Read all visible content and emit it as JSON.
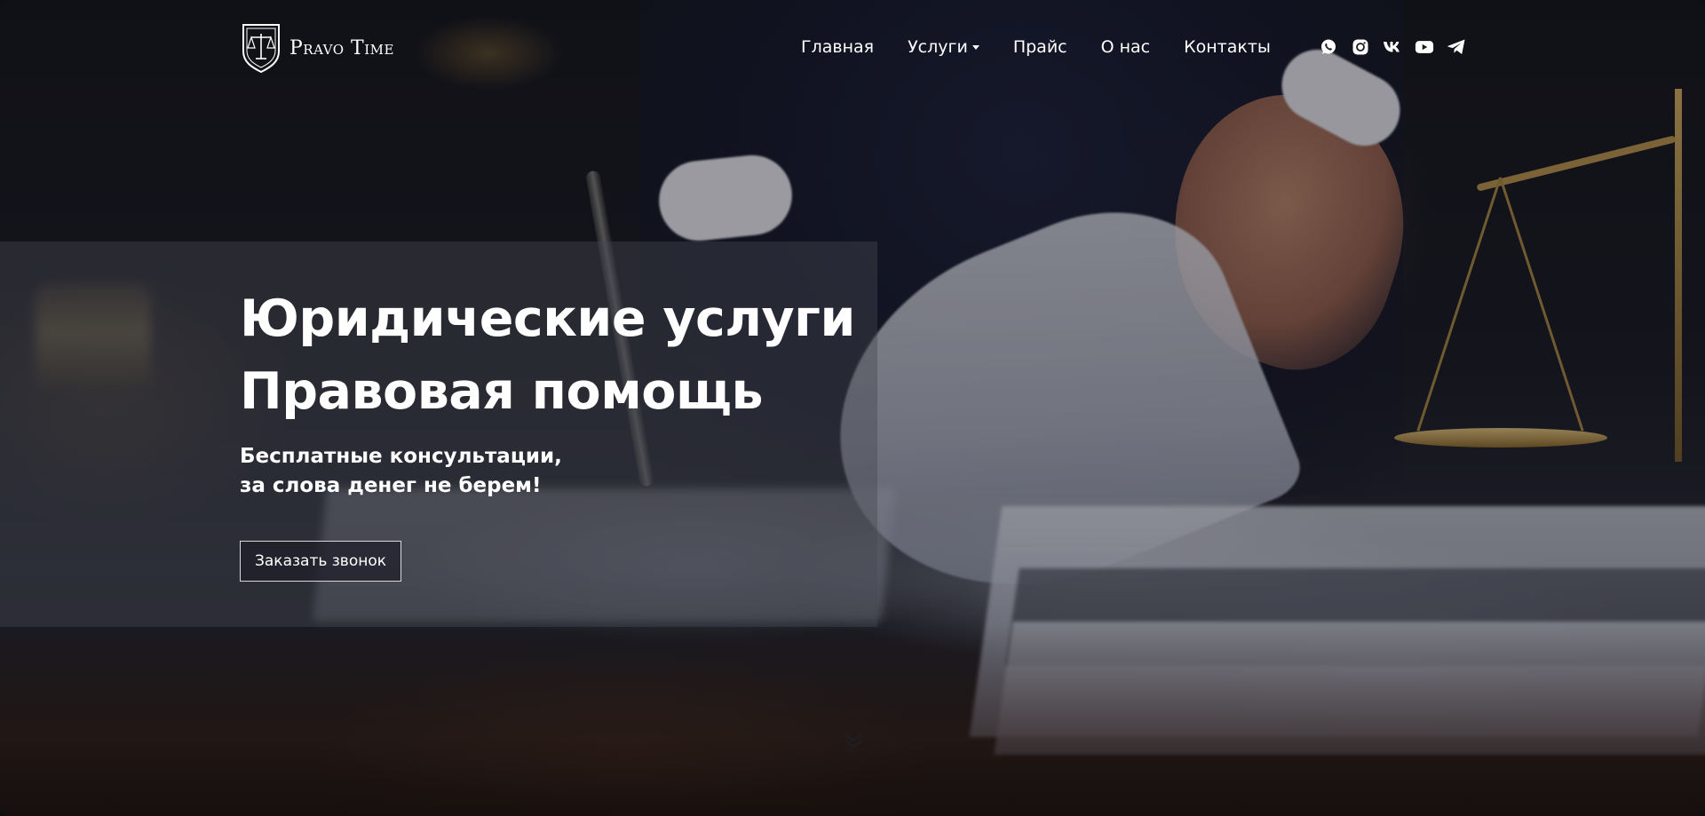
{
  "brand": {
    "name": "Pravo Time"
  },
  "nav": {
    "items": [
      {
        "label": "Главная"
      },
      {
        "label": "Услуги",
        "has_dropdown": true
      },
      {
        "label": "Прайс"
      },
      {
        "label": "О нас"
      },
      {
        "label": "Контакты"
      }
    ]
  },
  "socials": [
    {
      "icon": "whatsapp-icon"
    },
    {
      "icon": "instagram-icon"
    },
    {
      "icon": "vk-icon"
    },
    {
      "icon": "youtube-icon"
    },
    {
      "icon": "telegram-icon"
    }
  ],
  "hero": {
    "headline_line1": "Юридические услуги",
    "headline_line2": "Правовая помощь",
    "subline_line1": "Бесплатные консультации,",
    "subline_line2": "за слова денег не берем!",
    "cta_label": "Заказать звонок"
  },
  "colors": {
    "text": "#ffffff",
    "panel": "#464852",
    "accent_gold": "#b9944e"
  }
}
